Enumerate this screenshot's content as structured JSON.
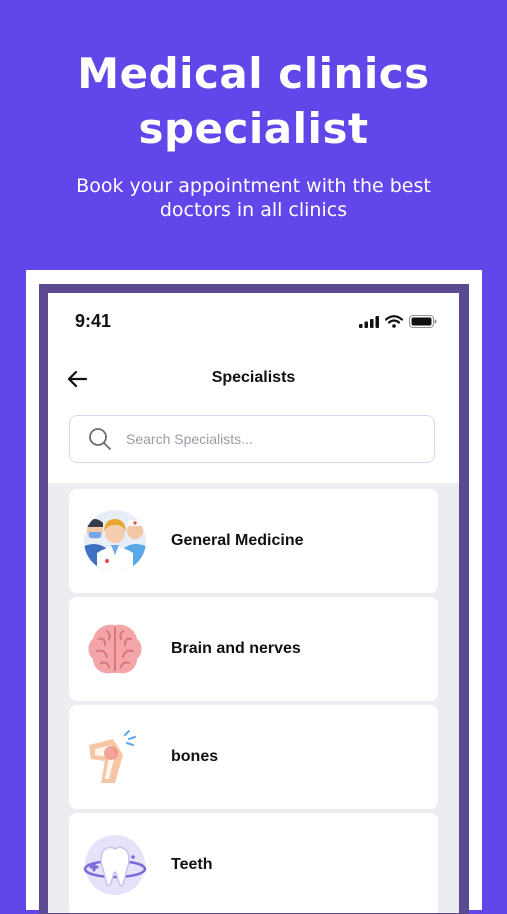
{
  "hero": {
    "title": "Medical clinics specialist",
    "subtitle": "Book your appointment with the best doctors in all clinics"
  },
  "status_bar": {
    "time": "9:41"
  },
  "header": {
    "title": "Specialists"
  },
  "search": {
    "placeholder": "Search Specialists..."
  },
  "specialists": [
    {
      "label": "General Medicine",
      "icon": "doctors-team-icon"
    },
    {
      "label": "Brain and nerves",
      "icon": "brain-icon"
    },
    {
      "label": "bones",
      "icon": "knee-joint-icon"
    },
    {
      "label": "Teeth",
      "icon": "tooth-icon"
    }
  ],
  "colors": {
    "background": "#6246EA",
    "device_frame": "#5B4A91",
    "list_background": "#ECECF1",
    "search_border": "#D8D5F5"
  }
}
